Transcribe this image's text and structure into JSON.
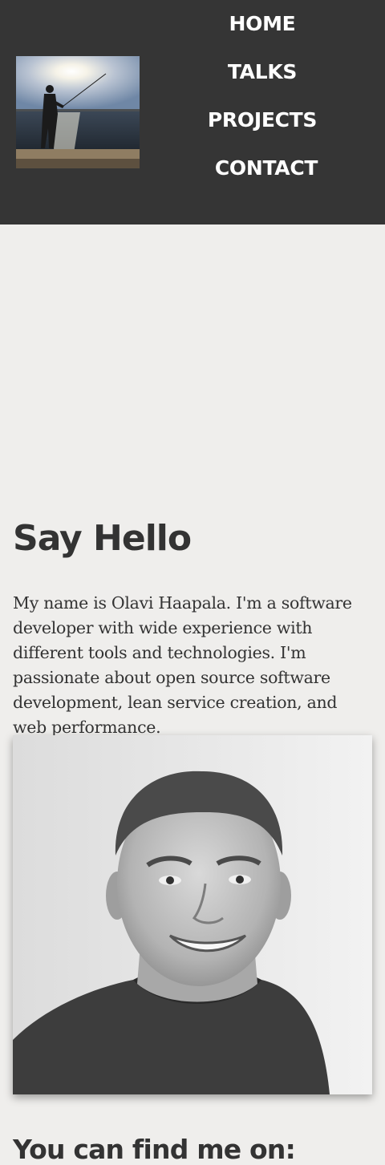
{
  "nav": {
    "items": [
      {
        "label": "HOME"
      },
      {
        "label": "TALKS"
      },
      {
        "label": "PROJECTS"
      },
      {
        "label": "CONTACT"
      }
    ]
  },
  "main": {
    "title": "Say Hello",
    "intro": "My name is Olavi Haapala. I'm a software developer with wide experience with different tools and technologies. I'm passionate about open source software development, lean service creation, and web performance.",
    "find_me_heading": "You can find me on:"
  },
  "colors": {
    "header_bg": "#353535",
    "page_bg": "#efeeec",
    "text": "#333333",
    "nav_text": "#ffffff"
  }
}
